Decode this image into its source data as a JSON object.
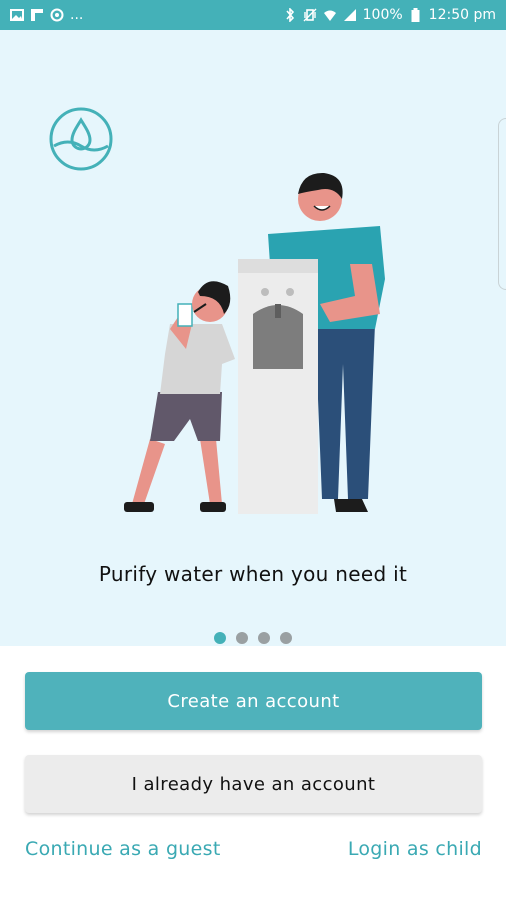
{
  "status_bar": {
    "left_icons": [
      "image-icon",
      "flipboard-icon",
      "sync-icon"
    ],
    "overflow": "...",
    "right_icons": [
      "bluetooth-icon",
      "vibrate-icon",
      "wifi-icon",
      "signal-icon"
    ],
    "battery": "100%",
    "time": "12:50 pm"
  },
  "hero": {
    "logo_icon": "water-drop-logo-icon",
    "tagline": "Purify water when you need it",
    "carousel": {
      "pages": 4,
      "active_index": 0
    }
  },
  "actions": {
    "primary_label": "Create an account",
    "secondary_label": "I already have an account",
    "guest_link": "Continue as a guest",
    "child_link": "Login as child"
  },
  "colors": {
    "accent": "#44b1b8",
    "hero_background": "#e6f6fc"
  }
}
